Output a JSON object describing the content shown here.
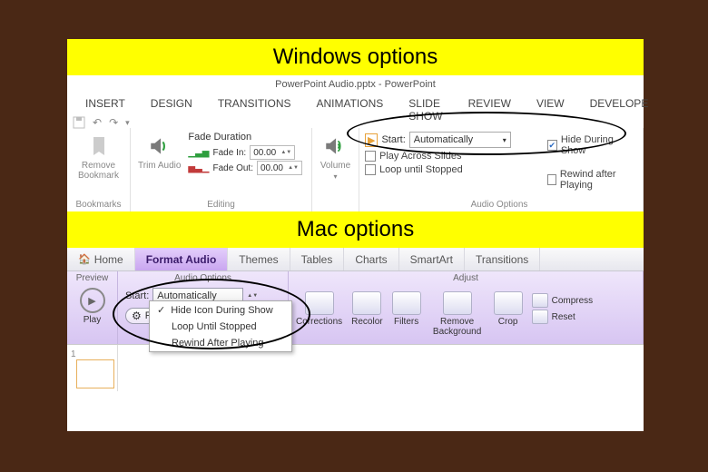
{
  "headers": {
    "windows": "Windows options",
    "mac": "Mac options"
  },
  "win": {
    "title": "PowerPoint Audio.pptx - PowerPoint",
    "tabs": [
      "INSERT",
      "DESIGN",
      "TRANSITIONS",
      "ANIMATIONS",
      "SLIDE SHOW",
      "REVIEW",
      "VIEW",
      "DEVELOPE"
    ],
    "remove_bookmark": "Remove Bookmark",
    "bookmarks_label": "Bookmarks",
    "trim_audio": "Trim Audio",
    "fade_duration": "Fade Duration",
    "fade_in": "Fade In:",
    "fade_out": "Fade Out:",
    "fade_in_val": "00.00",
    "fade_out_val": "00.00",
    "editing_label": "Editing",
    "volume": "Volume",
    "start_label": "Start:",
    "start_value": "Automatically",
    "play_across": "Play Across Slides",
    "loop_until": "Loop until Stopped",
    "hide_during": "Hide During Show",
    "rewind_after": "Rewind after Playing",
    "audio_options_label": "Audio Options"
  },
  "mac": {
    "tabs": {
      "home": "Home",
      "format_audio": "Format Audio",
      "themes": "Themes",
      "tables": "Tables",
      "charts": "Charts",
      "smartart": "SmartArt",
      "transitions": "Transitions"
    },
    "preview_label": "Preview",
    "play": "Play",
    "audio_options_label": "Audio Options",
    "start_label": "Start:",
    "start_value": "Automatically",
    "playback_options": "Playback Options",
    "dropdown": {
      "hide_icon": "Hide Icon During Show",
      "loop": "Loop Until Stopped",
      "rewind": "Rewind After Playing"
    },
    "adjust_label": "Adjust",
    "corrections": "Corrections",
    "recolor": "Recolor",
    "filters": "Filters",
    "remove_bg": "Remove Background",
    "crop": "Crop",
    "compress": "Compress",
    "reset": "Reset",
    "slide_num": "1"
  }
}
